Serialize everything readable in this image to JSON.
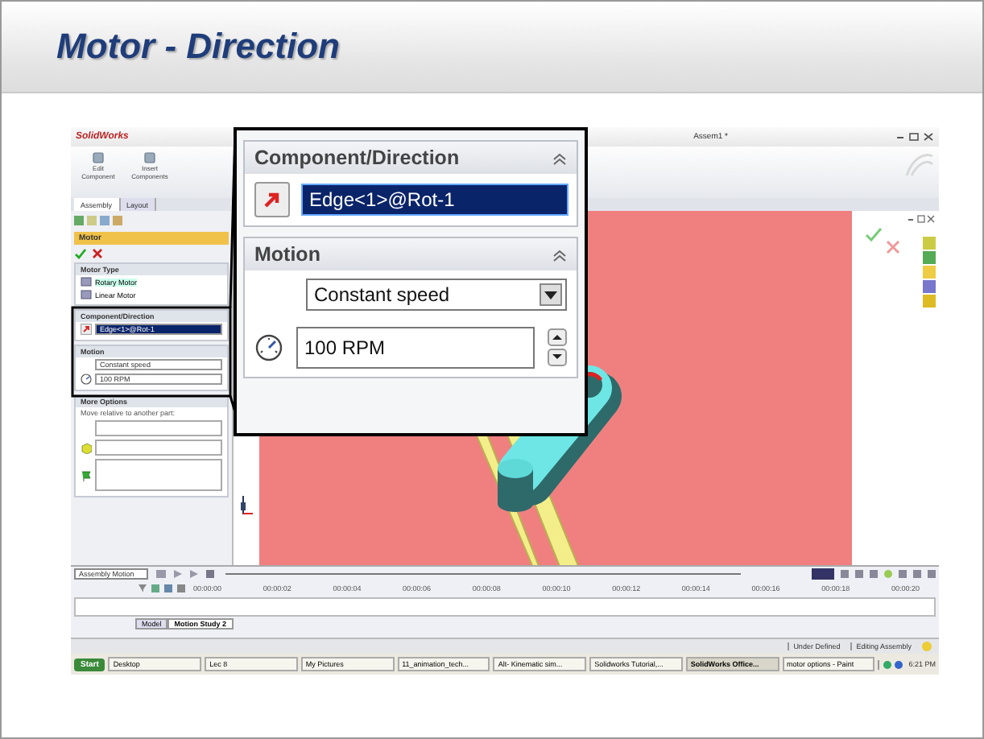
{
  "slide": {
    "title": "Motor - Direction"
  },
  "window": {
    "logo": "SolidWorks",
    "title": "Assem1 *"
  },
  "ribbon": {
    "buttons": [
      "Edit Component",
      "Insert Components"
    ]
  },
  "command_tabs": [
    {
      "label": "Assembly",
      "selected": true
    },
    {
      "label": "Layout",
      "selected": false
    }
  ],
  "property_manager": {
    "title": "Motor",
    "motor_type_header": "Motor Type",
    "motor_types": [
      {
        "label": "Rotary Motor",
        "selected": true
      },
      {
        "label": "Linear Motor",
        "selected": false
      }
    ],
    "direction_header": "Component/Direction",
    "direction_value": "Edge<1>@Rot-1",
    "motion_header": "Motion",
    "motion_type": "Constant speed",
    "speed": "100 RPM",
    "more_options_header": "More Options",
    "more_options_hint": "Move relative to another part:"
  },
  "callout": {
    "direction_header": "Component/Direction",
    "direction_value": "Edge<1>@Rot-1",
    "motion_header": "Motion",
    "motion_type": "Constant speed",
    "speed": "100 RPM"
  },
  "timeline": {
    "study_type": "Assembly Motion",
    "ticks": [
      "00:00:00",
      "00:00:02",
      "00:00:04",
      "00:00:06",
      "00:00:08",
      "00:00:10",
      "00:00:12",
      "00:00:14",
      "00:00:16",
      "00:00:18",
      "00:00:20"
    ],
    "tabs": [
      {
        "label": "Model",
        "selected": false
      },
      {
        "label": "Motion Study 2",
        "selected": true
      }
    ]
  },
  "status_bar": {
    "items": [
      "Under Defined",
      "Editing Assembly"
    ]
  },
  "taskbar": {
    "start": "Start",
    "items": [
      {
        "label": "Desktop",
        "selected": false
      },
      {
        "label": "Lec 8",
        "selected": false
      },
      {
        "label": "My Pictures",
        "selected": false
      },
      {
        "label": "11_animation_tech...",
        "selected": false
      },
      {
        "label": "Alt- Kinematic sim...",
        "selected": false
      },
      {
        "label": "Solidworks Tutorial,...",
        "selected": false
      },
      {
        "label": "SolidWorks Office...",
        "selected": true
      },
      {
        "label": "motor options - Paint",
        "selected": false
      }
    ],
    "clock": "6:21 PM"
  }
}
